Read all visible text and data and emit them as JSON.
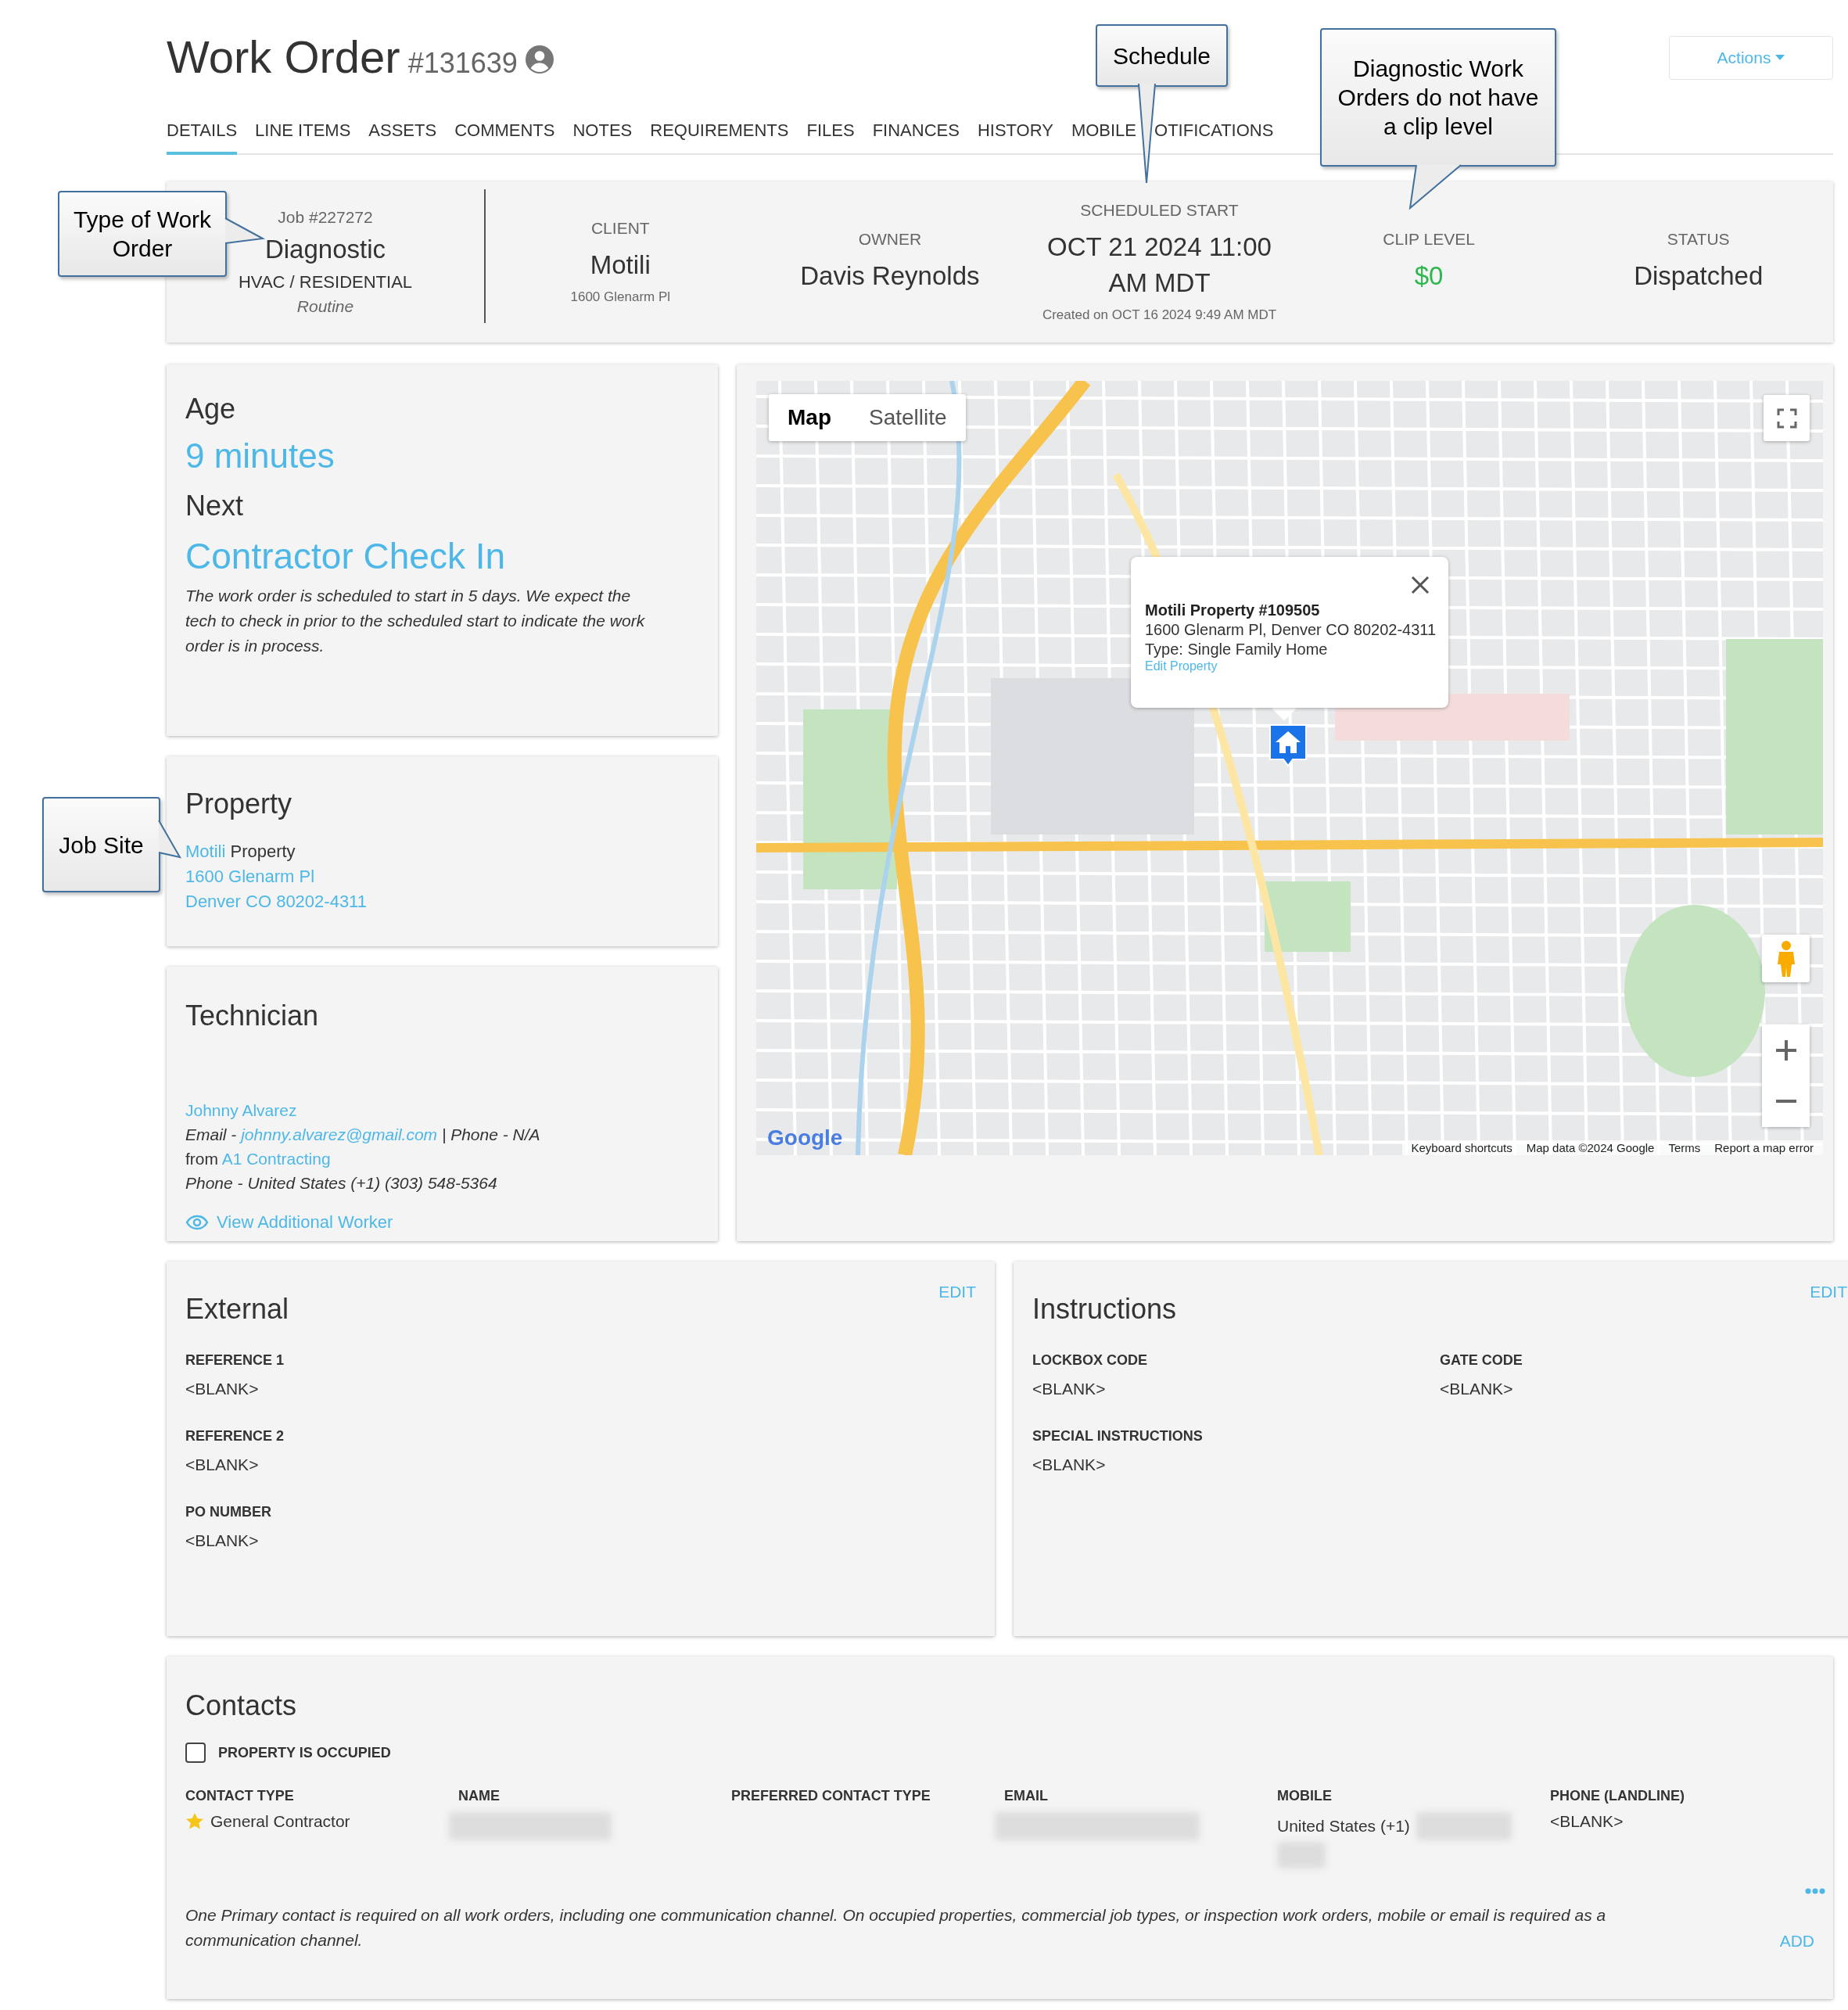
{
  "header": {
    "title": "Work Order",
    "number": "#131639",
    "actions": "Actions"
  },
  "tabs": [
    {
      "label": "DETAILS",
      "selected": true
    },
    {
      "label": "LINE ITEMS",
      "selected": false
    },
    {
      "label": "ASSETS",
      "selected": false
    },
    {
      "label": "COMMENTS",
      "selected": false
    },
    {
      "label": "NOTES",
      "selected": false
    },
    {
      "label": "REQUIREMENTS",
      "selected": false
    },
    {
      "label": "FILES",
      "selected": false
    },
    {
      "label": "FINANCES",
      "selected": false
    },
    {
      "label": "HISTORY",
      "selected": false
    },
    {
      "label": "MOBILE",
      "selected": false
    },
    {
      "label": "OTIFICATIONS",
      "selected": false
    }
  ],
  "summary": {
    "job": {
      "number": "Job #227272",
      "type": "Diagnostic",
      "trade": "HVAC / RESIDENTIAL",
      "priority": "Routine"
    },
    "fields": [
      {
        "kind": "text",
        "label": "CLIENT",
        "value": "Motili",
        "note": "1600 Glenarm Pl"
      },
      {
        "kind": "text",
        "label": "OWNER",
        "value": "Davis Reynolds"
      },
      {
        "kind": "text",
        "label": "SCHEDULED START",
        "value": "OCT 21 2024 11:00 AM MDT",
        "note": "Created on OCT 16 2024 9:49 AM MDT"
      },
      {
        "kind": "money",
        "label": "CLIP LEVEL",
        "value": "$0"
      },
      {
        "kind": "text",
        "label": "STATUS",
        "value": "Dispatched"
      }
    ]
  },
  "age_card": {
    "age_label": "Age",
    "age": "9 minutes",
    "next_label": "Next",
    "next": "Contractor Check In",
    "description": "The work order is scheduled to start in 5 days. We expect the tech to check in prior to the scheduled start to indicate the work order is in process."
  },
  "property_card": {
    "title": "Property",
    "client": "Motili",
    "type": "Property",
    "address_line1": "1600 Glenarm Pl",
    "address_line2": "Denver CO 80202-4311"
  },
  "technician_card": {
    "title": "Technician",
    "name": "Johnny Alvarez",
    "email_label": "Email - ",
    "email": "johnny.alvarez@gmail.com",
    "email_suffix": " | Phone - N/A",
    "from_label": "from ",
    "company": "A1 Contracting",
    "phone": "Phone - United States (+1) (303) 548-5364",
    "view_link": "View Additional Worker"
  },
  "map": {
    "type_buttons": [
      {
        "label": "Map",
        "selected": true
      },
      {
        "label": "Satellite",
        "selected": false
      }
    ],
    "popup": {
      "title": "Motili Property #109505",
      "address": "1600 Glenarm Pl, Denver CO 80202-4311",
      "type": "Type: Single Family Home",
      "link": "Edit Property"
    },
    "logo": "Google",
    "footer": [
      "Keyboard shortcuts",
      "Map data ©2024 Google",
      "Terms",
      "Report a map error"
    ]
  },
  "external": {
    "title": "External",
    "edit": "EDIT",
    "fields": [
      {
        "label": "REFERENCE 1",
        "value": "<BLANK>"
      },
      {
        "label": "REFERENCE 2",
        "value": "<BLANK>"
      },
      {
        "label": "PO NUMBER",
        "value": "<BLANK>"
      }
    ]
  },
  "instructions": {
    "title": "Instructions",
    "edit": "EDIT",
    "fields": [
      {
        "label": "LOCKBOX CODE",
        "value": "<BLANK>"
      },
      {
        "label": "GATE CODE",
        "value": "<BLANK>"
      },
      {
        "label": "SPECIAL INSTRUCTIONS",
        "value": "<BLANK>"
      }
    ]
  },
  "contacts": {
    "title": "Contacts",
    "occupied": {
      "label": "PROPERTY IS OCCUPIED",
      "checked": false
    },
    "columns": [
      "CONTACT TYPE",
      "NAME",
      "PREFERRED CONTACT TYPE",
      "EMAIL",
      "MOBILE",
      "PHONE (LANDLINE)"
    ],
    "rows": [
      {
        "primary": true,
        "contact_type": "General Contractor",
        "mobile": "United States (+1)",
        "phone_landline": "<BLANK>"
      }
    ],
    "note": "One Primary contact is required on all work orders, including one communication channel. On occupied properties, commercial job types, or inspection work orders, mobile or email is required as a communication channel.",
    "add": "ADD"
  },
  "callouts": [
    {
      "text": "Schedule"
    },
    {
      "text": "Diagnostic Work Orders do not have a clip level"
    },
    {
      "text": "Type of Work Order"
    },
    {
      "text": "Job Site"
    }
  ]
}
